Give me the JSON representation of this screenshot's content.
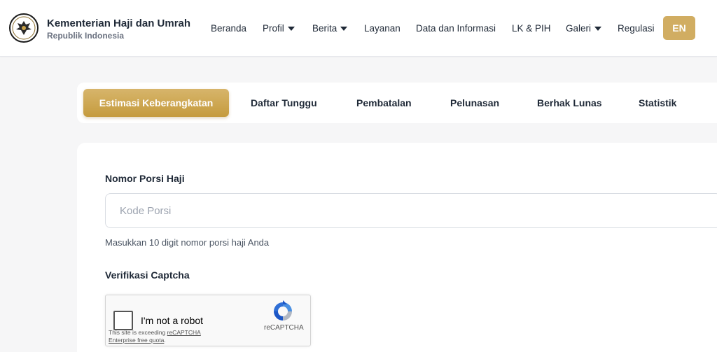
{
  "header": {
    "title": "Kementerian Haji dan Umrah",
    "subtitle": "Republik Indonesia",
    "logo_icon": "garuda-emblem",
    "nav": [
      {
        "label": "Beranda",
        "dropdown": false
      },
      {
        "label": "Profil",
        "dropdown": true
      },
      {
        "label": "Berita",
        "dropdown": true
      },
      {
        "label": "Layanan",
        "dropdown": false
      },
      {
        "label": "Data dan Informasi",
        "dropdown": false
      },
      {
        "label": "LK & PIH",
        "dropdown": false
      },
      {
        "label": "Galeri",
        "dropdown": true
      },
      {
        "label": "Regulasi",
        "dropdown": false
      }
    ],
    "lang_button": "EN"
  },
  "tabs": [
    {
      "label": "Estimasi Keberangkatan",
      "active": true
    },
    {
      "label": "Daftar Tunggu",
      "active": false
    },
    {
      "label": "Pembatalan",
      "active": false
    },
    {
      "label": "Pelunasan",
      "active": false
    },
    {
      "label": "Berhak Lunas",
      "active": false
    },
    {
      "label": "Statistik",
      "active": false
    }
  ],
  "form": {
    "porsi_label": "Nomor Porsi Haji",
    "porsi_placeholder": "Kode Porsi",
    "porsi_value": "",
    "porsi_help": "Masukkan 10 digit nomor porsi haji Anda",
    "captcha_label": "Verifikasi Captcha",
    "captcha": {
      "checkbox_label": "I'm not a robot",
      "brand": "reCAPTCHA",
      "note_prefix": "This site is exceeding ",
      "note_link1": "reCAPTCHA",
      "note_link2": "Enterprise free quota",
      "note_suffix": "."
    }
  },
  "colors": {
    "accent_gold": "#d1ad62",
    "tab_active_start": "#d7b56b",
    "tab_active_end": "#c59b3d",
    "page_bg": "#f6f6f7"
  }
}
